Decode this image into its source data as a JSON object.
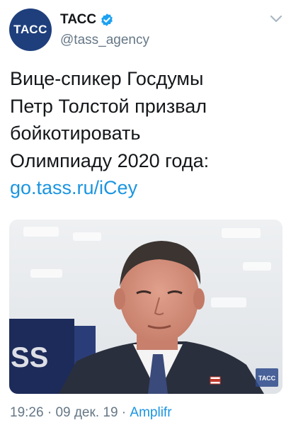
{
  "account": {
    "avatar_text": "ТАСС",
    "display_name": "ТАСС",
    "handle": "@tass_agency",
    "verified": true
  },
  "tweet": {
    "text_lines": [
      "Вице-спикер Госдумы",
      "Петр Толстой призвал",
      "бойкотировать",
      "Олимпиаду 2020 года:"
    ],
    "link": "go.tass.ru/iCey"
  },
  "media": {
    "watermark": "ТАСС",
    "backdrop_text": "SS"
  },
  "meta": {
    "time": "19:26",
    "separator": " · ",
    "date": "09 дек. 19",
    "source": "Amplifr"
  },
  "colors": {
    "brand_blue": "#1f3f7c",
    "link": "#1b95e0",
    "secondary_text": "#657786"
  },
  "icons": {
    "verified": "verified-badge-icon",
    "more": "chevron-down-icon"
  }
}
